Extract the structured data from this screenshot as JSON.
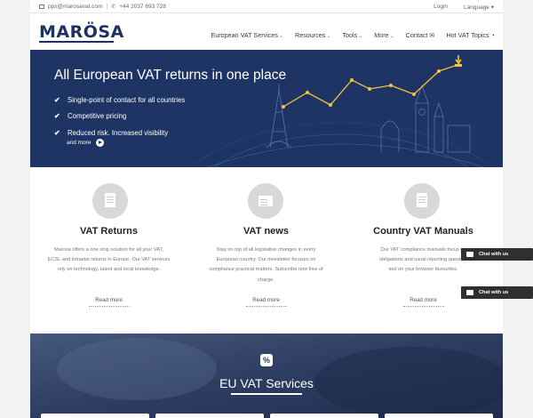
{
  "topbar": {
    "email": "pps@marosavat.com",
    "separator": "|",
    "phone": "+44 2037 693 728",
    "login_label": "Login",
    "language_label": "Language"
  },
  "header": {
    "logo_text": "MARÖSA",
    "nav": [
      {
        "label": "European VAT Services",
        "has_dropdown": true
      },
      {
        "label": "Resources",
        "has_dropdown": true
      },
      {
        "label": "Tools",
        "has_dropdown": true
      },
      {
        "label": "More",
        "has_dropdown": true
      },
      {
        "label": "Contact",
        "icon": "envelope-icon"
      },
      {
        "label": "Hot VAT Topics",
        "icon": "rss-icon"
      }
    ]
  },
  "hero": {
    "title": "All European VAT returns in one place",
    "items": [
      "Single-point of contact for all countries",
      "Competitive pricing",
      "Reduced risk. Increased visibility"
    ],
    "and_more": "and more",
    "background_color": "#1d3464",
    "accent_color": "#f5c23a"
  },
  "features": [
    {
      "icon": "document-icon",
      "title": "VAT Returns",
      "lines": [
        "Marosa offers a one stop solution for all your VAT,",
        "ECSL and Intrastat returns in Europe. Our VAT services",
        "rely on technology, talent and local knowledge."
      ],
      "read_more": "Read more"
    },
    {
      "icon": "news-icon",
      "title": "VAT news",
      "lines": [
        "Stay on top of all legislative changes in every",
        "European country. Our newsletter focuses on",
        "compliance practical matters. Subscribe now free of",
        "charge."
      ],
      "read_more": "Read more"
    },
    {
      "icon": "manual-icon",
      "title": "Country VAT Manuals",
      "lines": [
        "Our VAT compliance manuals focus on",
        "obligations and usual reporting question",
        "tool on your browser favourites."
      ],
      "read_more": "Read more"
    }
  ],
  "services": {
    "title": "EU VAT Services",
    "icon": "percent-icon",
    "icon_text": "%"
  },
  "chat": [
    {
      "label": "Chat with us"
    },
    {
      "label": "Chat with us"
    }
  ]
}
